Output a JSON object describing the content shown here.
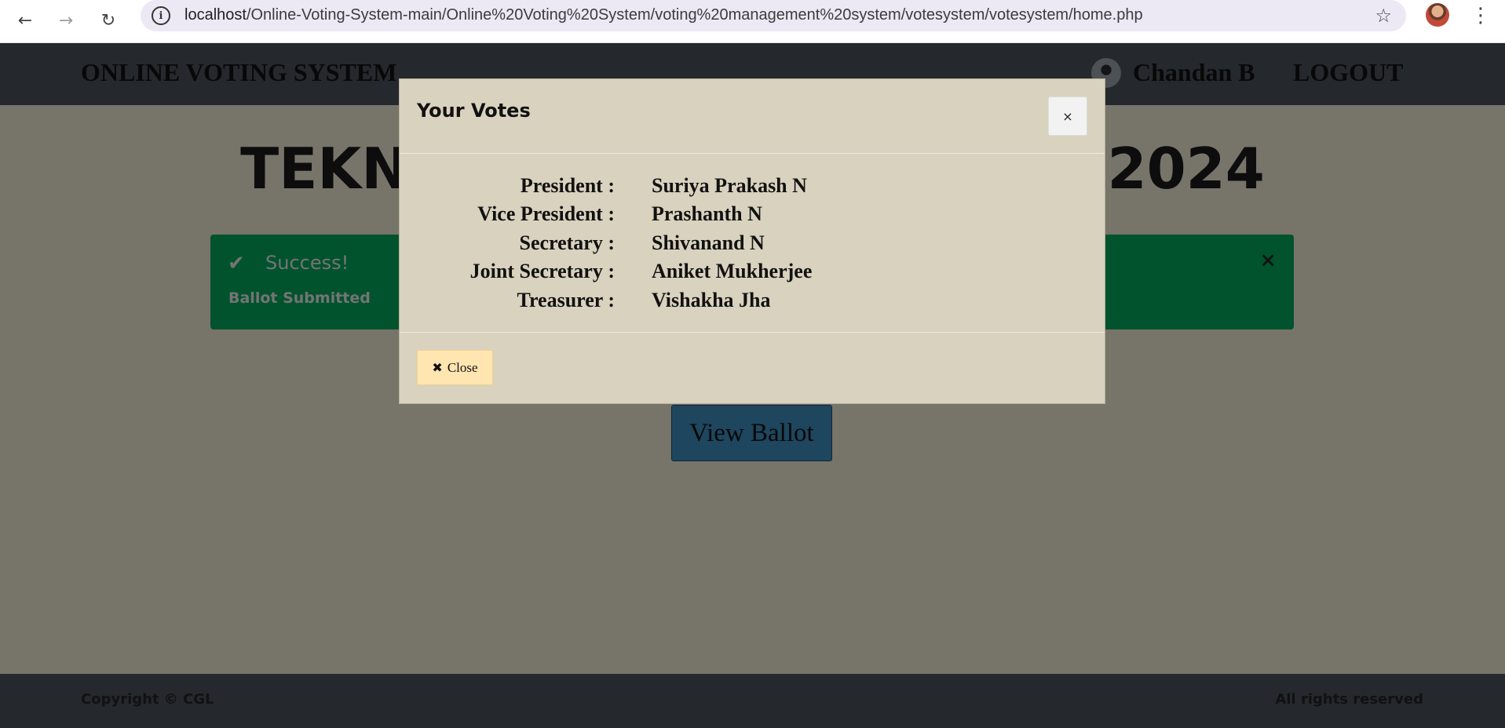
{
  "browser": {
    "url_host": "localhost",
    "url_path": "/Online-Voting-System-main/Online%20Voting%20System/voting%20management%20system/votesystem/votesystem/home.php"
  },
  "navbar": {
    "brand": "ONLINE VOTING SYSTEM",
    "user_name": "Chandan B",
    "logout_label": "LOGOUT"
  },
  "main": {
    "election_title": "TEKN",
    "election_title_end": "2024",
    "alert": {
      "title": "Success!",
      "message": "Ballot Submitted",
      "close_symbol": "×"
    },
    "view_ballot_label": "View Ballot"
  },
  "footer": {
    "left": "Copyright © CGL",
    "right": "All rights reserved"
  },
  "modal": {
    "title": "Your Votes",
    "close_symbol": "×",
    "votes": [
      {
        "position": "President :",
        "candidate": "Suriya Prakash N"
      },
      {
        "position": "Vice President :",
        "candidate": "Prashanth N"
      },
      {
        "position": "Secretary :",
        "candidate": "Shivanand N"
      },
      {
        "position": "Joint Secretary :",
        "candidate": "Aniket Mukherjee"
      },
      {
        "position": "Treasurer :",
        "candidate": "Vishakha Jha"
      }
    ],
    "close_button_label": "Close"
  },
  "colors": {
    "page_bg": "#efe9d4",
    "navbar_bg": "#4a5158",
    "alert_bg": "#00a65a",
    "button_bg": "#3c8dbc",
    "modal_bg": "#d8d2be",
    "close_btn_bg": "#ffe5b0"
  }
}
